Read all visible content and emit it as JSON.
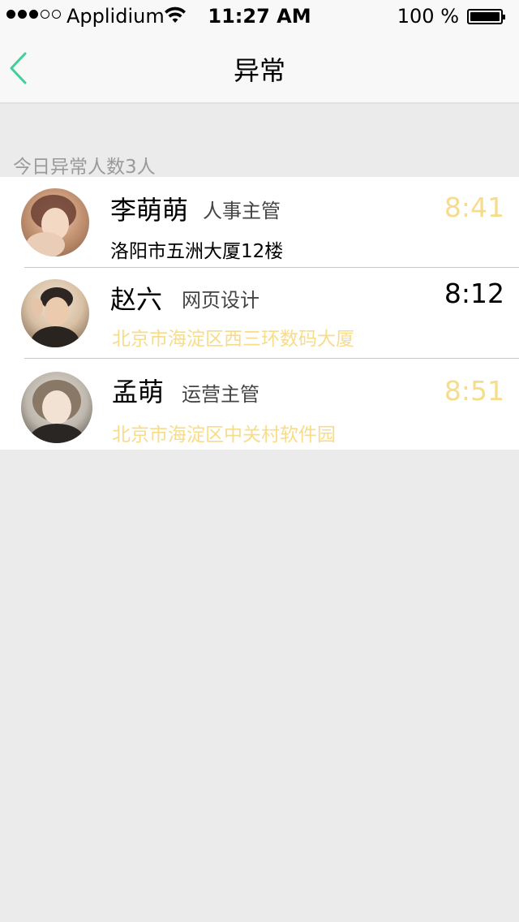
{
  "status_bar": {
    "carrier": "Applidium",
    "time": "11:27 AM",
    "battery": "100 %"
  },
  "nav": {
    "title": "异常",
    "back_icon": "chevron-left-icon"
  },
  "section": {
    "header": "今日异常人数3人"
  },
  "colors": {
    "accent": "#3ecf9a",
    "late_yellow": "#f7dc8a",
    "background": "#ebebeb"
  },
  "items": [
    {
      "name": "李萌萌",
      "role": "人事主管",
      "address": "洛阳市五洲大厦12楼",
      "time": "8:41",
      "time_color": "yellow",
      "address_color": "black"
    },
    {
      "name": "赵六",
      "role": "网页设计",
      "address": "北京市海淀区西三环数码大厦",
      "time": "8:12",
      "time_color": "black",
      "address_color": "yellow"
    },
    {
      "name": "孟萌",
      "role": "运营主管",
      "address": "北京市海淀区中关村软件园",
      "time": "8:51",
      "time_color": "yellow",
      "address_color": "yellow"
    }
  ]
}
